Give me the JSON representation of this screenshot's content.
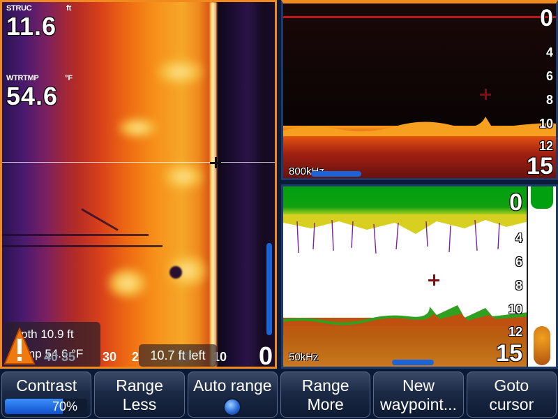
{
  "left_pane": {
    "structure": {
      "label": "STRUC",
      "unit": "ft",
      "value": "11.6"
    },
    "water_temp": {
      "label": "WTRTMP",
      "unit": "°F",
      "value": "54.6"
    },
    "info": {
      "depth": "pth 10.9  ft",
      "temp": "mp  54.6 °F"
    },
    "scale": [
      "40 35",
      "30",
      "2",
      "10",
      "10"
    ],
    "ft_left": "10.7 ft left",
    "zero": "0",
    "icons": {
      "warning": "warning-triangle-icon",
      "cursor": "crosshair-icon"
    }
  },
  "top_right_pane": {
    "depth_top": "0",
    "ticks": [
      "4",
      "6",
      "8",
      "10",
      "12"
    ],
    "depth_bottom": "15",
    "frequency": "800kHz"
  },
  "bottom_right_pane": {
    "depth_top": "0",
    "ticks": [
      "4",
      "6",
      "8",
      "10",
      "12"
    ],
    "depth_bottom": "15",
    "frequency": "50kHz"
  },
  "softkeys": [
    {
      "line1": "Contrast",
      "line2": "",
      "value": "70%",
      "level": 0.7
    },
    {
      "line1": "Range",
      "line2": "Less"
    },
    {
      "line1": "Auto range",
      "line2": ""
    },
    {
      "line1": "Range",
      "line2": "More"
    },
    {
      "line1": "New",
      "line2": "waypoint..."
    },
    {
      "line1": "Goto",
      "line2": "cursor"
    }
  ],
  "colors": {
    "accent": "#f08a1e",
    "softkey_blue": "#1a64d8",
    "bottom_green": "#00a010"
  }
}
